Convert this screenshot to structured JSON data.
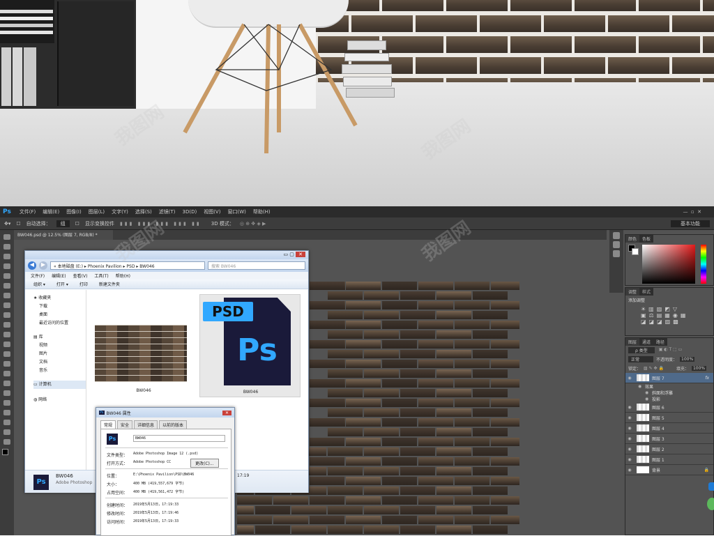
{
  "ps": {
    "logo": "Ps",
    "menu": [
      "文件(F)",
      "编辑(E)",
      "图像(I)",
      "图层(L)",
      "文字(Y)",
      "选择(S)",
      "滤镜(T)",
      "3D(D)",
      "视图(V)",
      "窗口(W)",
      "帮助(H)"
    ],
    "options": {
      "auto_select": "自动选择：",
      "layer": "组",
      "show_transform": "显示变换控件",
      "mode3d": "3D 模式：",
      "workspace": "基本功能"
    },
    "doc_tab": "BW046.psd @ 12.5% (图层 7, RGB/8) *",
    "panels": {
      "color_tabs": [
        "颜色",
        "色板"
      ],
      "adjust_tabs": [
        "调整",
        "样式"
      ],
      "adjust_title": "添加调整",
      "layers_tabs": [
        "图层",
        "通道",
        "路径"
      ],
      "filter": "ρ 类型",
      "blend": "正常",
      "opacity_label": "不透明度：",
      "opacity": "100%",
      "lock_label": "锁定：",
      "fill_label": "填充：",
      "fill": "100%"
    },
    "layers": [
      {
        "name": "图层 7",
        "fx": "fx",
        "selected": true
      },
      {
        "name": "效果",
        "sub": true
      },
      {
        "name": "斜面和浮雕",
        "sub": true
      },
      {
        "name": "投影",
        "sub": true
      },
      {
        "name": "图层 6"
      },
      {
        "name": "图层 5"
      },
      {
        "name": "图层 4"
      },
      {
        "name": "图层 3"
      },
      {
        "name": "图层 2"
      },
      {
        "name": "图层 1"
      },
      {
        "name": "背景",
        "locked": true
      }
    ],
    "colors": {
      "fg": "#000000",
      "bg": "#ffffff",
      "accent": "#1e7bd6"
    }
  },
  "explorer": {
    "path": [
      "本地磁盘 (E:)",
      "Phoenix Pavilion",
      "PSD",
      "BW046"
    ],
    "search": "搜索 BW046",
    "menu": [
      "文件(F)",
      "编辑(E)",
      "查看(V)",
      "工具(T)",
      "帮助(H)"
    ],
    "toolbar": [
      "组织 ▾",
      "打开 ▾",
      "打印",
      "新建文件夹"
    ],
    "nav": {
      "fav_title": "收藏夹",
      "favs": [
        "下载",
        "桌面",
        "最近访问的位置"
      ],
      "lib_title": "库",
      "libs": [
        "视频",
        "图片",
        "文档",
        "音乐"
      ],
      "computer": "计算机",
      "network": "网络"
    },
    "files": [
      {
        "name": "BW046"
      },
      {
        "name": "BW046"
      }
    ],
    "psd_label": "PSD",
    "ps_label": "Ps",
    "status": {
      "name": "BW046",
      "type": "Adobe Photoshop",
      "time": "17:19"
    }
  },
  "props": {
    "title": "BW046 属性",
    "tabs": [
      "常规",
      "安全",
      "详细信息",
      "以前的版本"
    ],
    "filename": "BW046",
    "rows": [
      {
        "k": "文件类型：",
        "v": "Adobe Photoshop Image 12 (.psd)"
      },
      {
        "k": "打开方式：",
        "v": "Adobe Photoshop CC",
        "btn": "更改(C)..."
      },
      {
        "k": "位置：",
        "v": "E:\\Phoenix Pavilion\\PSD\\BW046"
      },
      {
        "k": "大小：",
        "v": "400 MB (419,557,679 字节)"
      },
      {
        "k": "占用空间：",
        "v": "400 MB (419,561,472 字节)"
      },
      {
        "k": "创建时间：",
        "v": "2019年5月13日，17:19:33"
      },
      {
        "k": "修改时间：",
        "v": "2019年5月13日，17:19:46"
      },
      {
        "k": "访问时间：",
        "v": "2019年5月13日，17:19:33"
      }
    ]
  },
  "watermark": "我图网"
}
